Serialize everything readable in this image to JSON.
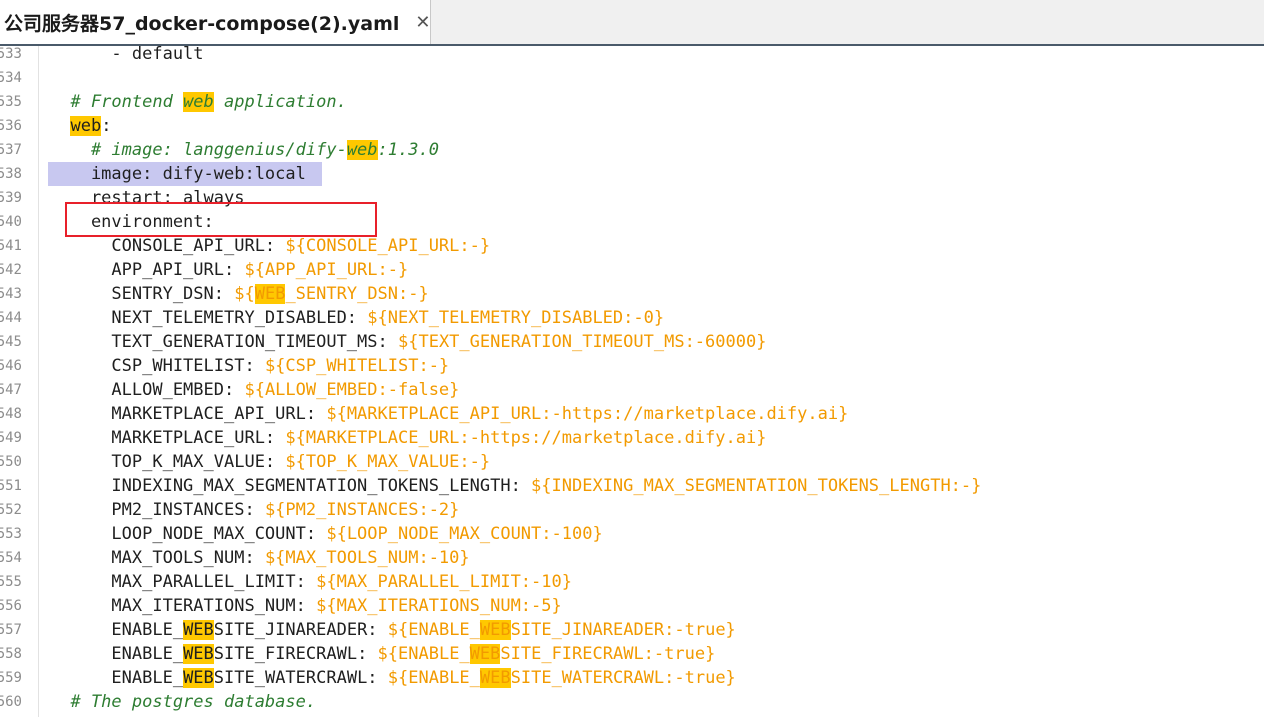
{
  "tab": {
    "title": "公司服务器57_docker-compose(2).yaml",
    "close_label": "✕"
  },
  "lines": [
    {
      "num": "533",
      "tokens": [
        {
          "t": "      - default",
          "c": ""
        }
      ]
    },
    {
      "num": "534",
      "tokens": []
    },
    {
      "num": "535",
      "tokens": [
        {
          "t": "  # Frontend ",
          "c": "cmt"
        },
        {
          "t": "web",
          "c": "cmt hl"
        },
        {
          "t": " application.",
          "c": "cmt"
        }
      ]
    },
    {
      "num": "536",
      "tokens": [
        {
          "t": "  ",
          "c": ""
        },
        {
          "t": "web",
          "c": "hl"
        },
        {
          "t": ":",
          "c": ""
        }
      ]
    },
    {
      "num": "537",
      "tokens": [
        {
          "t": "    # image: langgenius/dify-",
          "c": "cmt"
        },
        {
          "t": "web",
          "c": "cmt hl"
        },
        {
          "t": ":1.3.0",
          "c": "cmt"
        }
      ]
    },
    {
      "num": "538",
      "current": true,
      "tokens": [
        {
          "t": "    image: dify-web:local",
          "c": ""
        }
      ]
    },
    {
      "num": "539",
      "tokens": [
        {
          "t": "    restart: always",
          "c": ""
        }
      ]
    },
    {
      "num": "540",
      "tokens": [
        {
          "t": "    environment:",
          "c": ""
        }
      ]
    },
    {
      "num": "541",
      "tokens": [
        {
          "t": "      CONSOLE_API_URL: ",
          "c": ""
        },
        {
          "t": "${CONSOLE_API_URL:-}",
          "c": "val"
        }
      ]
    },
    {
      "num": "542",
      "tokens": [
        {
          "t": "      APP_API_URL: ",
          "c": ""
        },
        {
          "t": "${APP_API_URL:-}",
          "c": "val"
        }
      ]
    },
    {
      "num": "543",
      "tokens": [
        {
          "t": "      SENTRY_DSN: ",
          "c": ""
        },
        {
          "t": "${",
          "c": "val"
        },
        {
          "t": "WEB",
          "c": "val hl"
        },
        {
          "t": "_SENTRY_DSN:-}",
          "c": "val"
        }
      ]
    },
    {
      "num": "544",
      "tokens": [
        {
          "t": "      NEXT_TELEMETRY_DISABLED: ",
          "c": ""
        },
        {
          "t": "${NEXT_TELEMETRY_DISABLED:-0}",
          "c": "val"
        }
      ]
    },
    {
      "num": "545",
      "tokens": [
        {
          "t": "      TEXT_GENERATION_TIMEOUT_MS: ",
          "c": ""
        },
        {
          "t": "${TEXT_GENERATION_TIMEOUT_MS:-60000}",
          "c": "val"
        }
      ]
    },
    {
      "num": "546",
      "tokens": [
        {
          "t": "      CSP_WHITELIST: ",
          "c": ""
        },
        {
          "t": "${CSP_WHITELIST:-}",
          "c": "val"
        }
      ]
    },
    {
      "num": "547",
      "tokens": [
        {
          "t": "      ALLOW_EMBED: ",
          "c": ""
        },
        {
          "t": "${ALLOW_EMBED:-false}",
          "c": "val"
        }
      ]
    },
    {
      "num": "548",
      "tokens": [
        {
          "t": "      MARKETPLACE_API_URL: ",
          "c": ""
        },
        {
          "t": "${MARKETPLACE_API_URL:-https://marketplace.dify.ai}",
          "c": "val"
        }
      ]
    },
    {
      "num": "549",
      "tokens": [
        {
          "t": "      MARKETPLACE_URL: ",
          "c": ""
        },
        {
          "t": "${MARKETPLACE_URL:-https://marketplace.dify.ai}",
          "c": "val"
        }
      ]
    },
    {
      "num": "550",
      "tokens": [
        {
          "t": "      TOP_K_MAX_VALUE: ",
          "c": ""
        },
        {
          "t": "${TOP_K_MAX_VALUE:-}",
          "c": "val"
        }
      ]
    },
    {
      "num": "551",
      "tokens": [
        {
          "t": "      INDEXING_MAX_SEGMENTATION_TOKENS_LENGTH: ",
          "c": ""
        },
        {
          "t": "${INDEXING_MAX_SEGMENTATION_TOKENS_LENGTH:-}",
          "c": "val"
        }
      ]
    },
    {
      "num": "552",
      "tokens": [
        {
          "t": "      PM2_INSTANCES: ",
          "c": ""
        },
        {
          "t": "${PM2_INSTANCES:-2}",
          "c": "val"
        }
      ]
    },
    {
      "num": "553",
      "tokens": [
        {
          "t": "      LOOP_NODE_MAX_COUNT: ",
          "c": ""
        },
        {
          "t": "${LOOP_NODE_MAX_COUNT:-100}",
          "c": "val"
        }
      ]
    },
    {
      "num": "554",
      "tokens": [
        {
          "t": "      MAX_TOOLS_NUM: ",
          "c": ""
        },
        {
          "t": "${MAX_TOOLS_NUM:-10}",
          "c": "val"
        }
      ]
    },
    {
      "num": "555",
      "tokens": [
        {
          "t": "      MAX_PARALLEL_LIMIT: ",
          "c": ""
        },
        {
          "t": "${MAX_PARALLEL_LIMIT:-10}",
          "c": "val"
        }
      ]
    },
    {
      "num": "556",
      "tokens": [
        {
          "t": "      MAX_ITERATIONS_NUM: ",
          "c": ""
        },
        {
          "t": "${MAX_ITERATIONS_NUM:-5}",
          "c": "val"
        }
      ]
    },
    {
      "num": "557",
      "tokens": [
        {
          "t": "      ENABLE_",
          "c": ""
        },
        {
          "t": "WEB",
          "c": "hl"
        },
        {
          "t": "SITE_JINAREADER: ",
          "c": ""
        },
        {
          "t": "${ENABLE_",
          "c": "val"
        },
        {
          "t": "WEB",
          "c": "val hl"
        },
        {
          "t": "SITE_JINAREADER:-true}",
          "c": "val"
        }
      ]
    },
    {
      "num": "558",
      "tokens": [
        {
          "t": "      ENABLE_",
          "c": ""
        },
        {
          "t": "WEB",
          "c": "hl"
        },
        {
          "t": "SITE_FIRECRAWL: ",
          "c": ""
        },
        {
          "t": "${ENABLE_",
          "c": "val"
        },
        {
          "t": "WEB",
          "c": "val hl"
        },
        {
          "t": "SITE_FIRECRAWL:-true}",
          "c": "val"
        }
      ]
    },
    {
      "num": "559",
      "tokens": [
        {
          "t": "      ENABLE_",
          "c": ""
        },
        {
          "t": "WEB",
          "c": "hl"
        },
        {
          "t": "SITE_WATERCRAWL: ",
          "c": ""
        },
        {
          "t": "${ENABLE_",
          "c": "val"
        },
        {
          "t": "WEB",
          "c": "val hl"
        },
        {
          "t": "SITE_WATERCRAWL:-true}",
          "c": "val"
        }
      ]
    },
    {
      "num": "560",
      "tokens": [
        {
          "t": "  # The postgres database.",
          "c": "cmt"
        }
      ]
    }
  ]
}
